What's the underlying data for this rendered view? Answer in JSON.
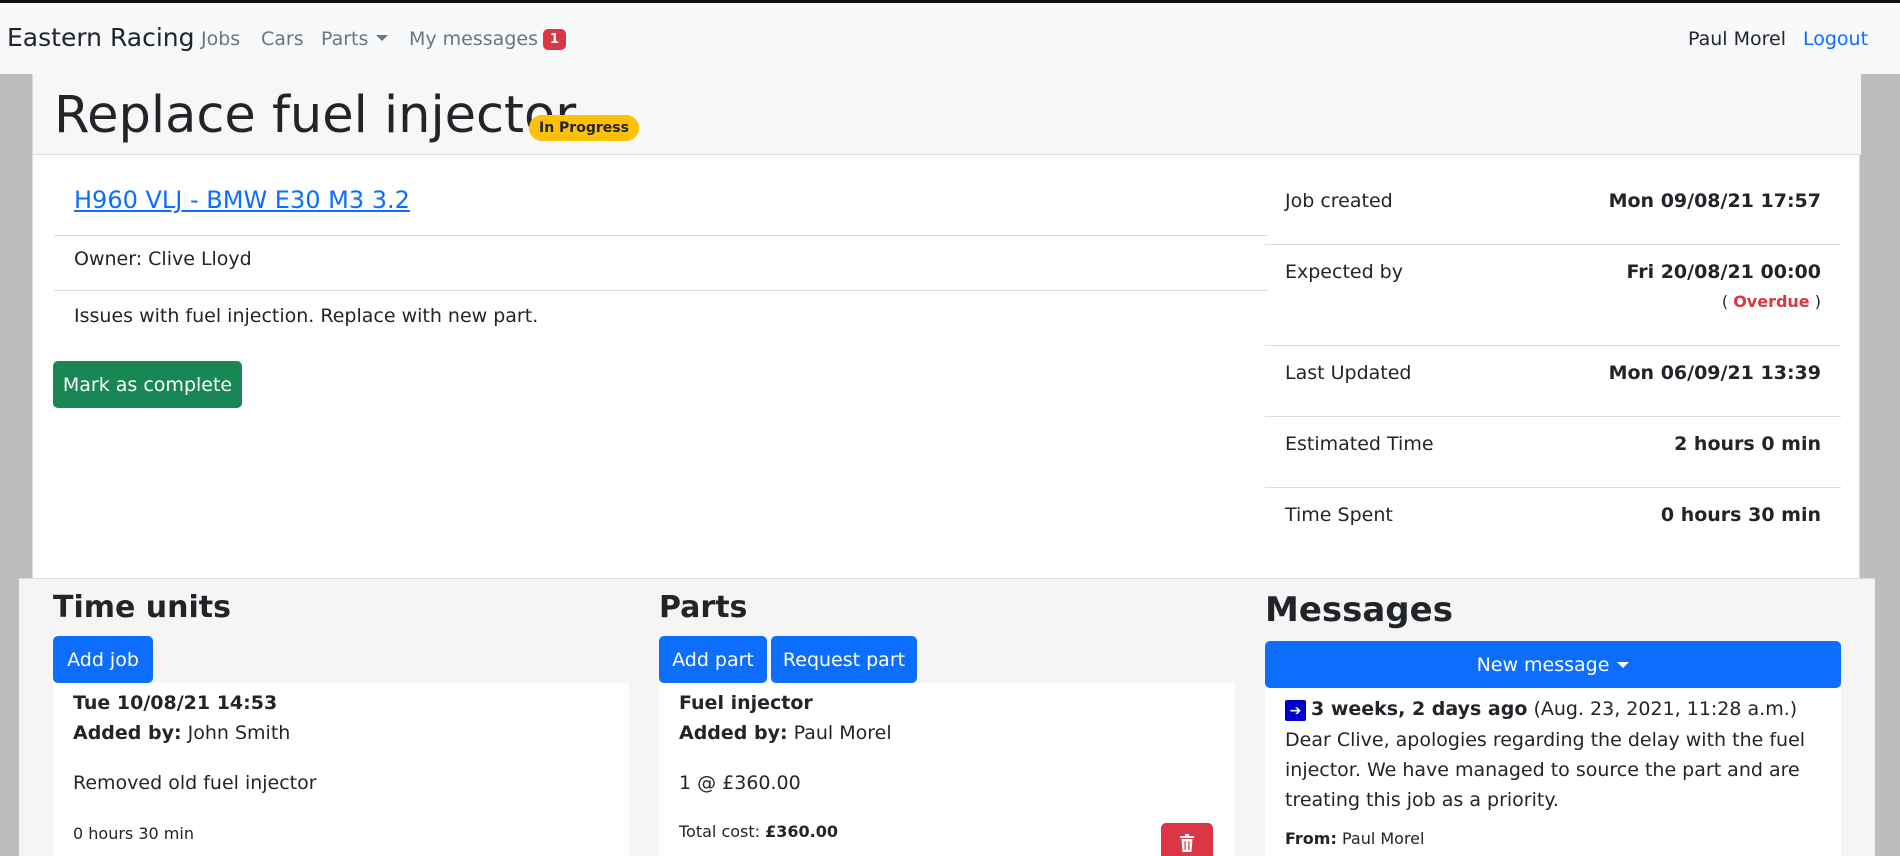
{
  "nav": {
    "brand": "Eastern Racing",
    "jobs": "Jobs",
    "cars": "Cars",
    "parts": "Parts",
    "messages": "My messages",
    "messages_count": "1",
    "user": "Paul Morel",
    "logout": "Logout"
  },
  "job": {
    "title": "Replace fuel injector",
    "status": "In Progress",
    "car_link": "H960 VLJ - BMW E30 M3 3.2",
    "owner": "Owner: Clive Lloyd",
    "description": "Issues with fuel injection. Replace with new part.",
    "complete_button": "Mark as complete"
  },
  "info": {
    "created_label": "Job created",
    "created_value": "Mon 09/08/21 17:57",
    "expected_label": "Expected by",
    "expected_value": "Fri 20/08/21 00:00",
    "overdue_open": "(",
    "overdue": "Overdue",
    "overdue_close": ")",
    "updated_label": "Last Updated",
    "updated_value": "Mon 06/09/21 13:39",
    "estimated_label": "Estimated Time",
    "estimated_value": "2 hours 0 min",
    "spent_label": "Time Spent",
    "spent_value": "0 hours 30 min"
  },
  "time_units": {
    "title": "Time units",
    "add_button": "Add job",
    "entry": {
      "date": "Tue 10/08/21 14:53",
      "added_by_label": "Added by:",
      "added_by": "John Smith",
      "note": "Removed old fuel injector",
      "duration": "0 hours 30 min"
    }
  },
  "parts": {
    "title": "Parts",
    "add_button": "Add part",
    "request_button": "Request part",
    "entry": {
      "name": "Fuel injector",
      "added_by_label": "Added by:",
      "added_by": "Paul Morel",
      "qty_price": "1 @ £360.00",
      "total_label": "Total cost:",
      "total_value": "£360.00"
    }
  },
  "messages": {
    "title": "Messages",
    "new_button": "New message",
    "entry": {
      "age": "3 weeks, 2 days ago",
      "timestamp": "(Aug. 23, 2021, 11:28 a.m.)",
      "body": "Dear Clive, apologies regarding the delay with the fuel injector. We have managed to source the part and are treating this job as a priority.",
      "from_label": "From:",
      "from": "Paul Morel"
    }
  }
}
